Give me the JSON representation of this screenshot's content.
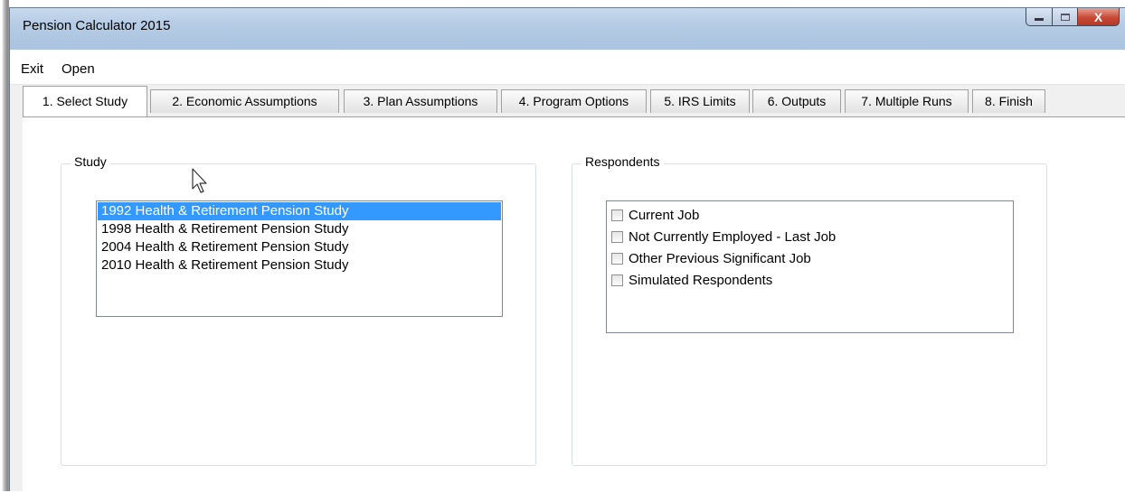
{
  "window": {
    "title": "Pension Calculator 2015",
    "close_glyph": "X"
  },
  "menu": {
    "items": [
      {
        "label": "Exit"
      },
      {
        "label": "Open"
      }
    ]
  },
  "tabs": [
    {
      "label": "1. Select Study",
      "active": true
    },
    {
      "label": "2. Economic Assumptions"
    },
    {
      "label": "3. Plan Assumptions"
    },
    {
      "label": "4. Program Options"
    },
    {
      "label": "5. IRS Limits"
    },
    {
      "label": "6. Outputs"
    },
    {
      "label": "7. Multiple Runs"
    },
    {
      "label": "8. Finish"
    }
  ],
  "study": {
    "legend": "Study",
    "items": [
      {
        "label": "1992 Health & Retirement Pension Study",
        "selected": true
      },
      {
        "label": "1998 Health & Retirement Pension Study"
      },
      {
        "label": "2004 Health & Retirement Pension Study"
      },
      {
        "label": "2010 Health & Retirement Pension Study"
      }
    ]
  },
  "respondents": {
    "legend": "Respondents",
    "items": [
      {
        "label": "Current Job",
        "checked": false
      },
      {
        "label": "Not Currently Employed - Last Job",
        "checked": false
      },
      {
        "label": "Other Previous Significant Job",
        "checked": false
      },
      {
        "label": "Simulated Respondents",
        "checked": false
      }
    ]
  },
  "colors": {
    "selection": "#3399ff",
    "titlebar": "#b5cce5",
    "close_button": "#c94a36"
  }
}
